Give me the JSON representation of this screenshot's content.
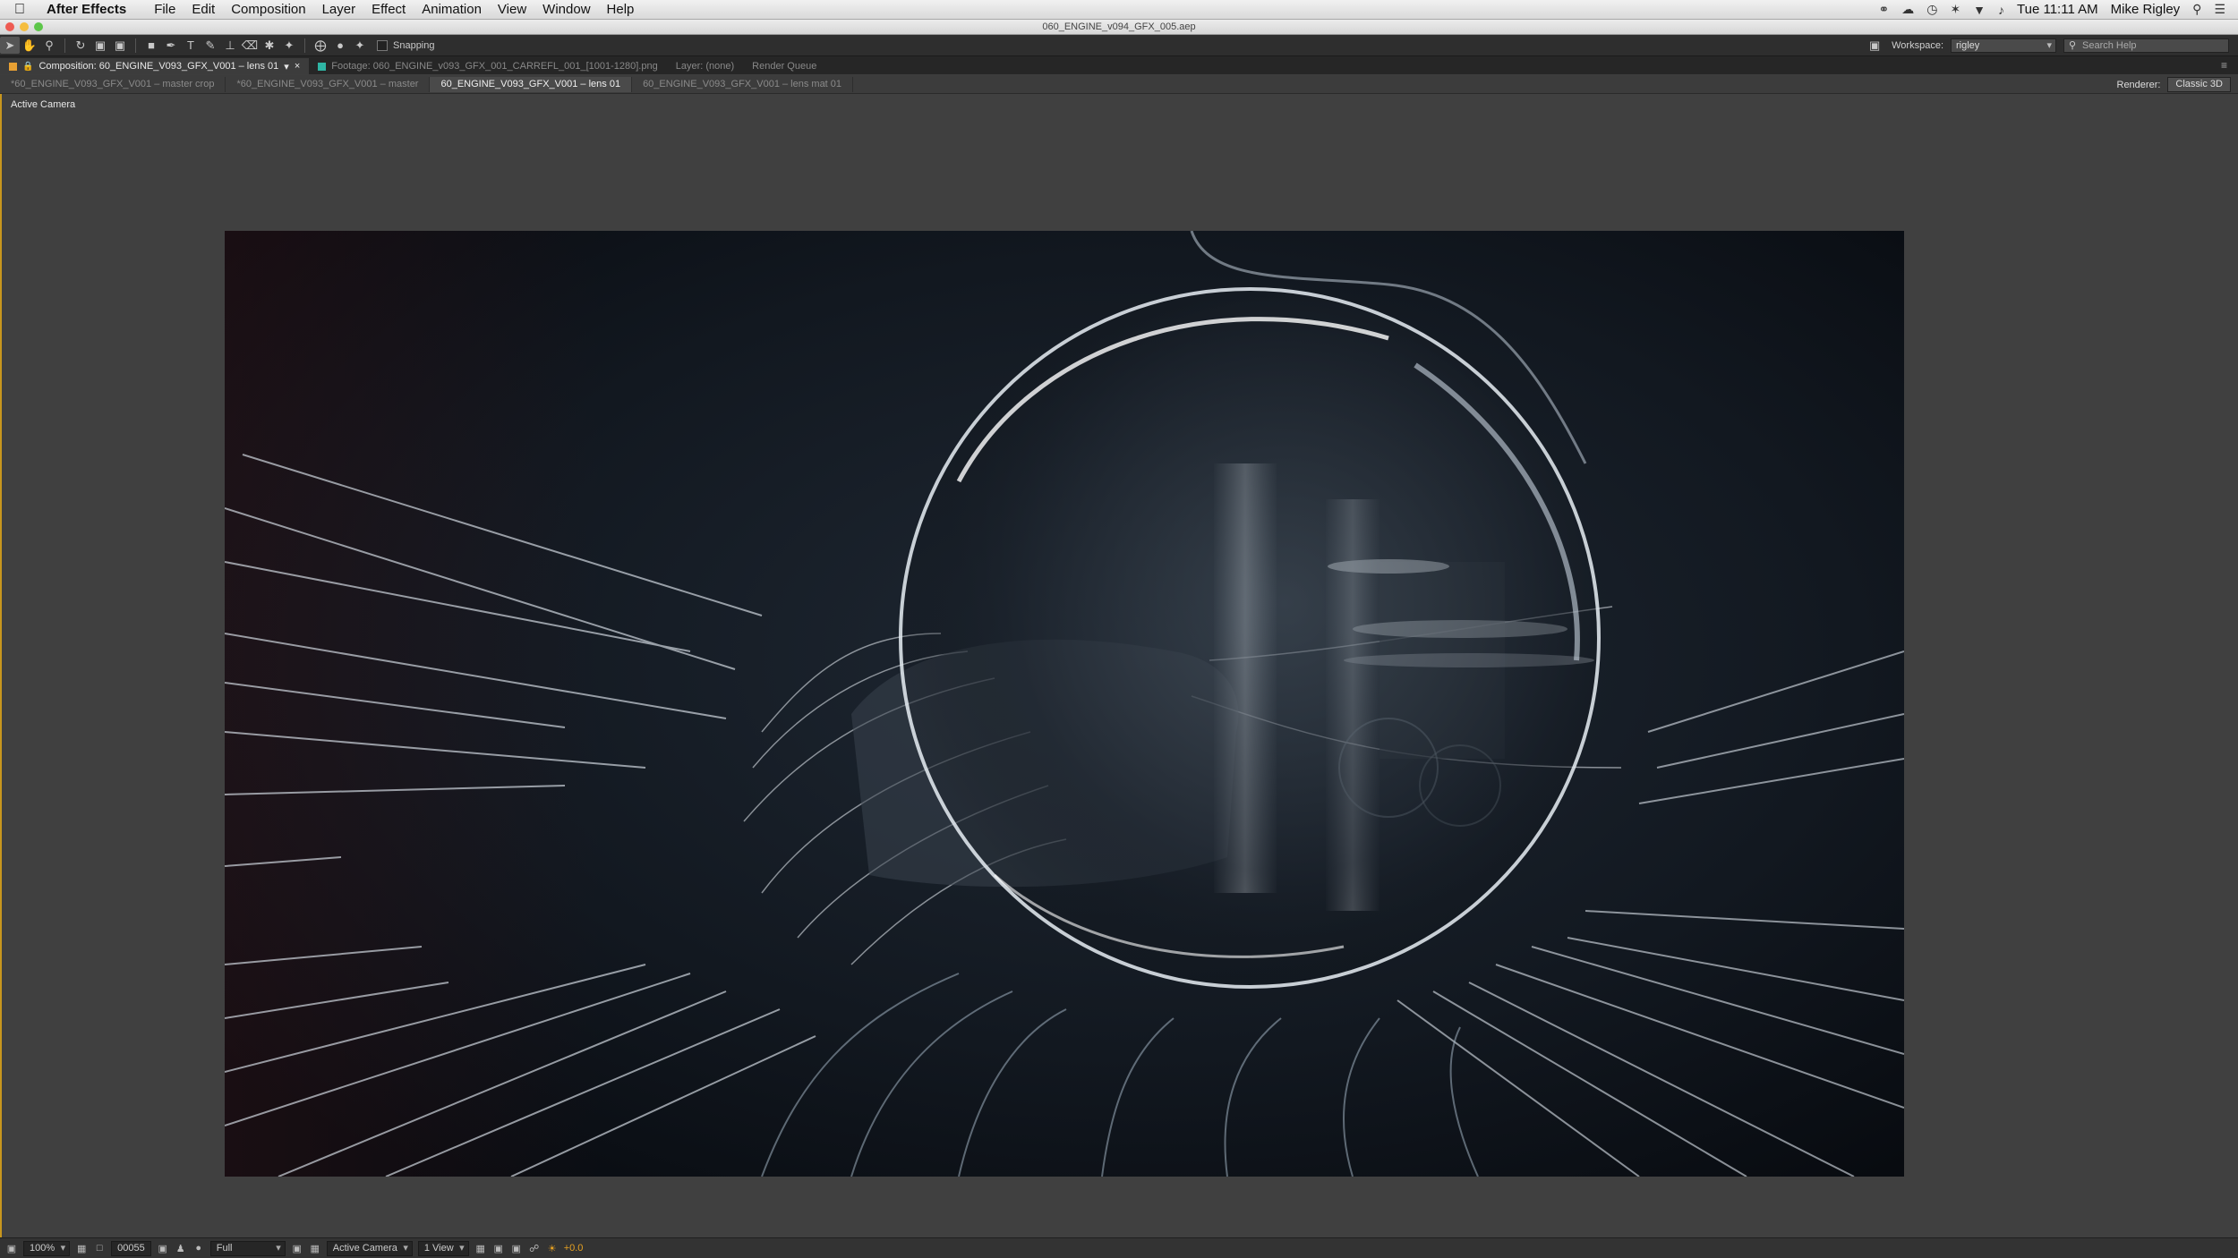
{
  "menubar": {
    "app_name": "After Effects",
    "items": [
      "File",
      "Edit",
      "Composition",
      "Layer",
      "Effect",
      "Animation",
      "View",
      "Window",
      "Help"
    ],
    "clock": "Tue 11:11 AM",
    "user": "Mike Rigley"
  },
  "window": {
    "title": "060_ENGINE_v094_GFX_005.aep"
  },
  "toolbar": {
    "snapping_label": "Snapping",
    "workspace_label": "Workspace:",
    "workspace_value": "rigley",
    "search_placeholder": "Search Help"
  },
  "panels": {
    "composition_tab": "Composition: 60_ENGINE_V093_GFX_V001 – lens 01",
    "footage_tab": "Footage: 060_ENGINE_v093_GFX_001_CARREFL_001_[1001-1280].png",
    "layer_tab": "Layer: (none)",
    "render_queue_tab": "Render Queue",
    "comp_label_color": "#e8a033",
    "footage_label_color": "#2fb5a4"
  },
  "comp_tabs": [
    "*60_ENGINE_V093_GFX_V001 – master crop",
    "*60_ENGINE_V093_GFX_V001 – master",
    "60_ENGINE_V093_GFX_V001 – lens 01",
    "60_ENGINE_V093_GFX_V001 – lens mat 01"
  ],
  "renderer": {
    "label": "Renderer:",
    "value": "Classic 3D"
  },
  "viewer": {
    "camera_label": "Active Camera"
  },
  "footer": {
    "zoom": "100%",
    "timecode": "00055",
    "resolution": "Full",
    "camera": "Active Camera",
    "views": "1 View",
    "exposure": "+0.0"
  },
  "colors": {
    "accent": "#c8961e",
    "canvas_bg": "#0e1218"
  }
}
